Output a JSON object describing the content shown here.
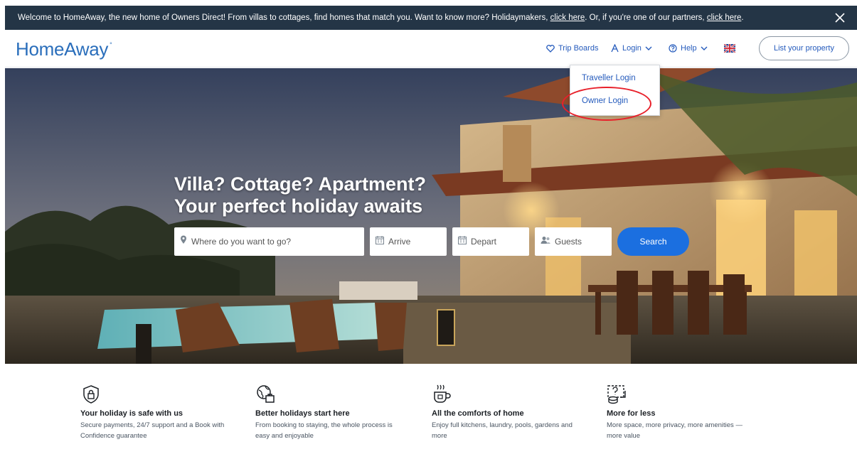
{
  "announcement": {
    "text_1": "Welcome to HomeAway, the new home of Owners Direct! From villas to cottages, find homes that match you. Want to know more? Holidaymakers, ",
    "link_1": "click here",
    "text_2": ". Or, if you're one of our partners, ",
    "link_2": "click here",
    "text_3": "."
  },
  "header": {
    "logo": "HomeAway",
    "logo_mark": "°",
    "trip_boards": "Trip Boards",
    "login": "Login",
    "help": "Help",
    "list_property": "List your property"
  },
  "login_menu": {
    "items": [
      "Traveller Login",
      "Owner Login"
    ]
  },
  "hero": {
    "headline_line1": "Villa? Cottage? Apartment?",
    "headline_line2": "Your perfect holiday awaits"
  },
  "search": {
    "destination_placeholder": "Where do you want to go?",
    "arrive_placeholder": "Arrive",
    "depart_placeholder": "Depart",
    "guests_placeholder": "Guests",
    "button": "Search"
  },
  "features": [
    {
      "icon": "shield-lock-icon",
      "title": "Your holiday is safe with us",
      "desc_1": "Secure payments, 24/7 support and a Book with",
      "desc_2": "Confidence guarantee"
    },
    {
      "icon": "globe-bag-icon",
      "title": "Better holidays start here",
      "desc_1": "From booking to staying, the whole process is",
      "desc_2": "easy and enjoyable"
    },
    {
      "icon": "hot-cup-icon",
      "title": "All the comforts of home",
      "desc_1": "Enjoy full kitchens, laundry, pools, gardens and",
      "desc_2": "more"
    },
    {
      "icon": "house-money-icon",
      "title": "More for less",
      "desc_1": "More space, more privacy, more amenities —",
      "desc_2": "more value"
    }
  ],
  "colors": {
    "brand_blue": "#2a6ebb",
    "link_blue": "#245abc",
    "search_button": "#1b6fe0",
    "announcement_bg": "#243546",
    "highlight_red": "#e8202a"
  }
}
